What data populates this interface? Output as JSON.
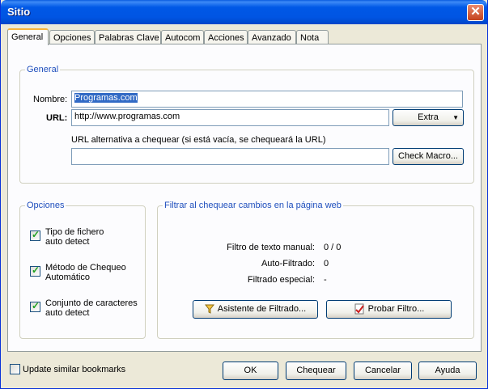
{
  "window": {
    "title": "Sitio",
    "close_glyph": "✕"
  },
  "tabs": [
    {
      "label": "General",
      "active": true
    },
    {
      "label": "Opciones"
    },
    {
      "label": "Palabras Clave"
    },
    {
      "label": "Autocom"
    },
    {
      "label": "Acciones"
    },
    {
      "label": "Avanzado"
    },
    {
      "label": "Nota"
    }
  ],
  "general": {
    "legend": "General",
    "name_label": "Nombre:",
    "name_value": "Programas.com",
    "url_label": "URL:",
    "url_value": "http://www.programas.com",
    "extra_label": "Extra",
    "alt_url_label": "URL alternativa a chequear (si está vacía, se chequeará la URL)",
    "alt_url_value": "",
    "check_macro_label": "Check Macro..."
  },
  "opciones": {
    "legend": "Opciones",
    "items": [
      {
        "line1": "Tipo de fichero",
        "line2": "auto detect",
        "checked": true
      },
      {
        "line1": "Método de Chequeo",
        "line2": "Automático",
        "checked": true
      },
      {
        "line1": "Conjunto de caracteres",
        "line2": "auto detect",
        "checked": true
      }
    ]
  },
  "filtrar": {
    "legend": "Filtrar al chequear cambios en la página web",
    "rows": [
      {
        "label": "Filtro de texto manual:",
        "value": "0 / 0"
      },
      {
        "label": "Auto-Filtrado:",
        "value": "0"
      },
      {
        "label": "Filtrado especial:",
        "value": "-"
      }
    ],
    "wizard_label": "Asistente de Filtrado...",
    "wizard_icon": "funnel-icon",
    "test_label": "Probar Filtro...",
    "test_icon": "checkmark-document-icon"
  },
  "footer": {
    "update_label": "Update similar bookmarks",
    "update_checked": false,
    "ok_label": "OK",
    "check_label": "Chequear",
    "cancel_label": "Cancelar",
    "help_label": "Ayuda"
  },
  "colors": {
    "title_bar": "#0055e3",
    "legend_text": "#1f4fbd",
    "selection": "#316ac5"
  }
}
